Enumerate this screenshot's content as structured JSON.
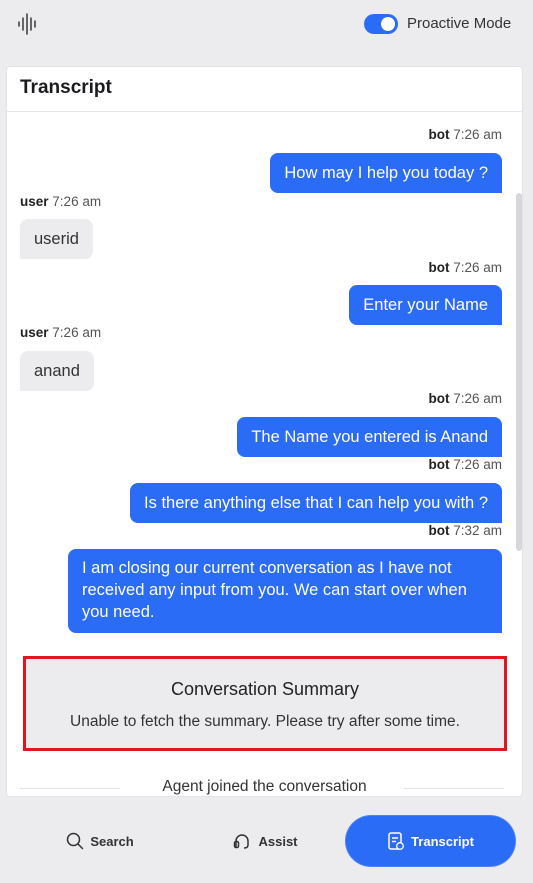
{
  "header": {
    "toggle_label": "Proactive Mode",
    "toggle_on": true
  },
  "panel": {
    "title": "Transcript"
  },
  "messages": [
    {
      "sender": "bot",
      "time": "7:26 am",
      "text": "How may I help you today ?"
    },
    {
      "sender": "user",
      "time": "7:26 am",
      "text": "userid"
    },
    {
      "sender": "bot",
      "time": "7:26 am",
      "text": "Enter your Name"
    },
    {
      "sender": "user",
      "time": "7:26 am",
      "text": "anand"
    },
    {
      "sender": "bot",
      "time": "7:26 am",
      "text": "The Name you entered is Anand"
    },
    {
      "sender": "bot",
      "time": "7:26 am",
      "text": "Is there anything else that I can help you with ?"
    },
    {
      "sender": "bot",
      "time": "7:32 am",
      "text": "I am closing our current conversation as I have not received any input from you. We can start over when you need."
    }
  ],
  "summary": {
    "title": "Conversation Summary",
    "text": "Unable to fetch the summary. Please try after some time."
  },
  "status": {
    "agent_joined": "Agent joined the conversation"
  },
  "nav": {
    "search": "Search",
    "assist": "Assist",
    "transcript": "Transcript"
  },
  "colors": {
    "accent": "#2b6cf6",
    "summary_border": "#e0161d"
  }
}
